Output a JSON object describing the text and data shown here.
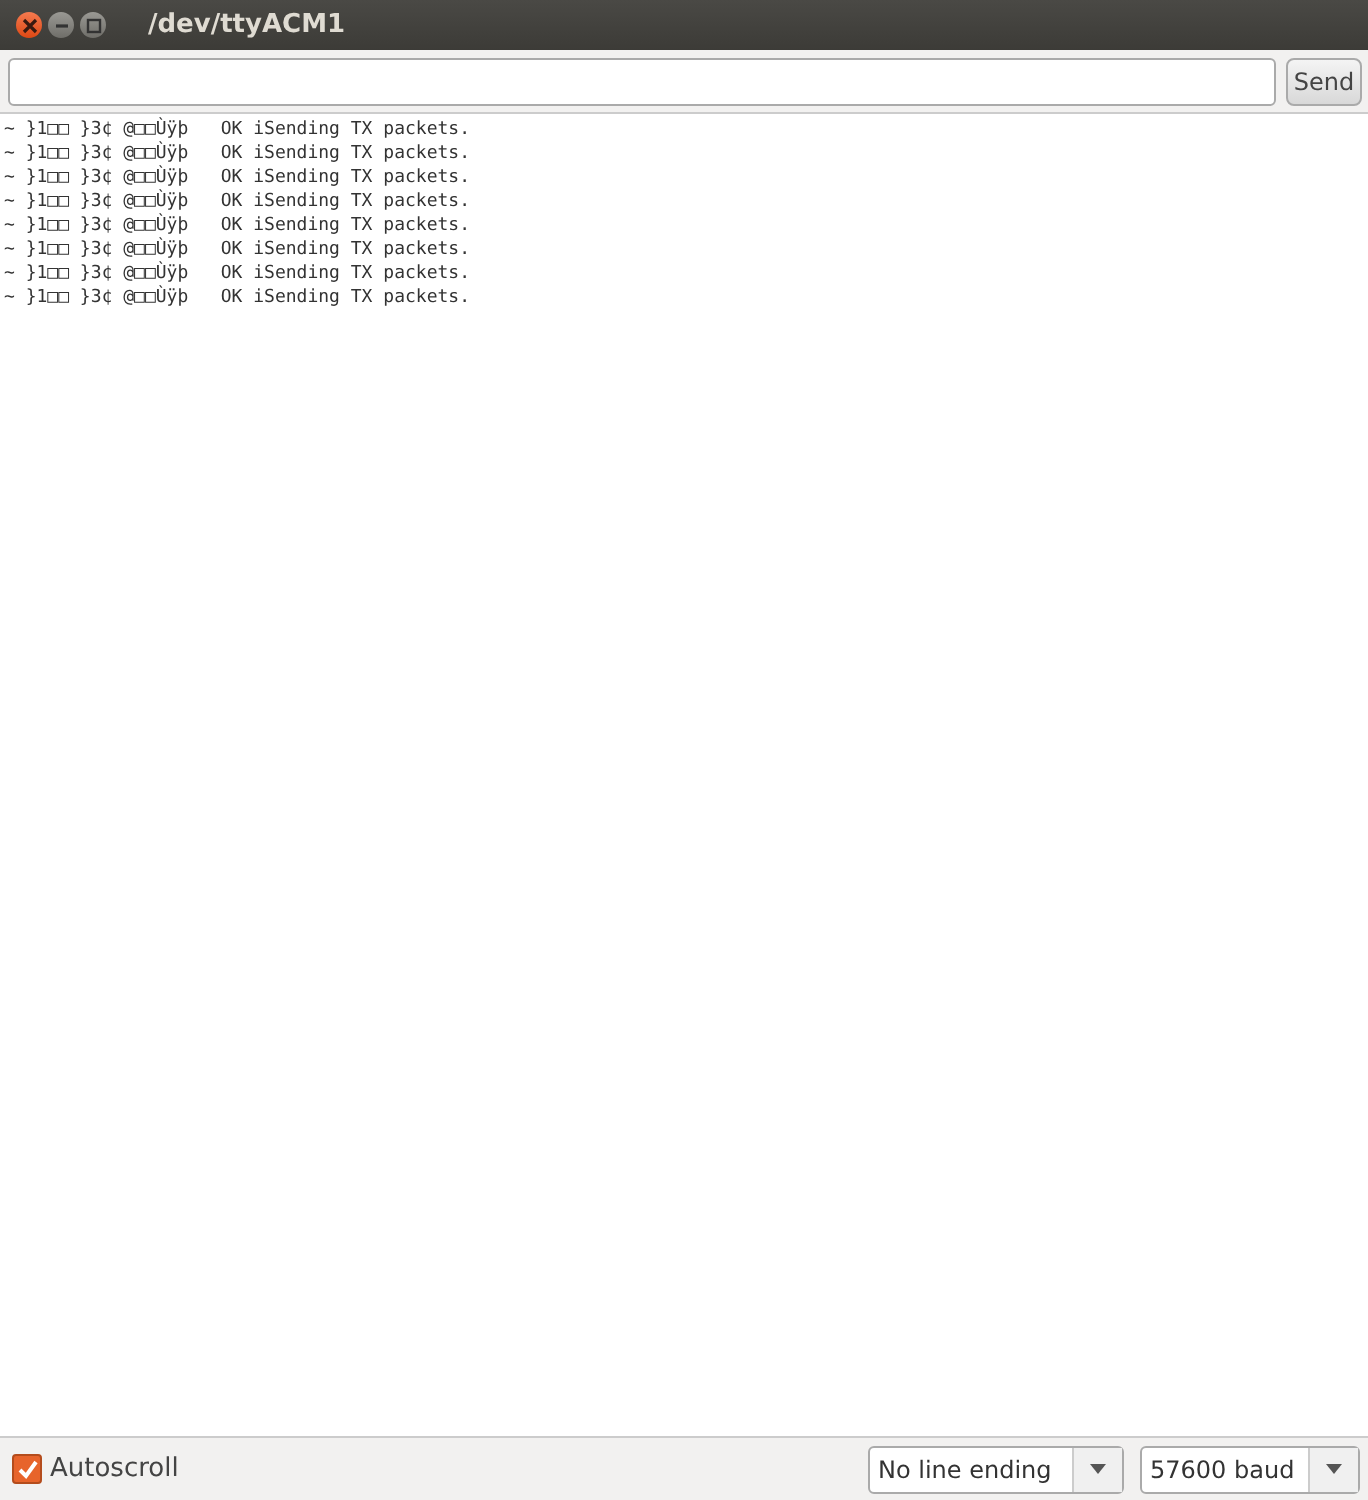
{
  "window": {
    "title": "/dev/ttyACM1"
  },
  "send_button": {
    "label": "Send"
  },
  "output_lines": [
    "~ }1□□ }3¢ @□□Ùÿþ   OK iSending TX packets.",
    "~ }1□□ }3¢ @□□Ùÿþ   OK iSending TX packets.",
    "~ }1□□ }3¢ @□□Ùÿþ   OK iSending TX packets.",
    "~ }1□□ }3¢ @□□Ùÿþ   OK iSending TX packets.",
    "~ }1□□ }3¢ @□□Ùÿþ   OK iSending TX packets.",
    "~ }1□□ }3¢ @□□Ùÿþ   OK iSending TX packets.",
    "~ }1□□ }3¢ @□□Ùÿþ   OK iSending TX packets.",
    "~ }1□□ }3¢ @□□Ùÿþ   OK iSending TX packets."
  ],
  "autoscroll": {
    "label": "Autoscroll",
    "checked": true
  },
  "line_ending": {
    "value": "No line ending"
  },
  "baud": {
    "value": "57600 baud"
  }
}
